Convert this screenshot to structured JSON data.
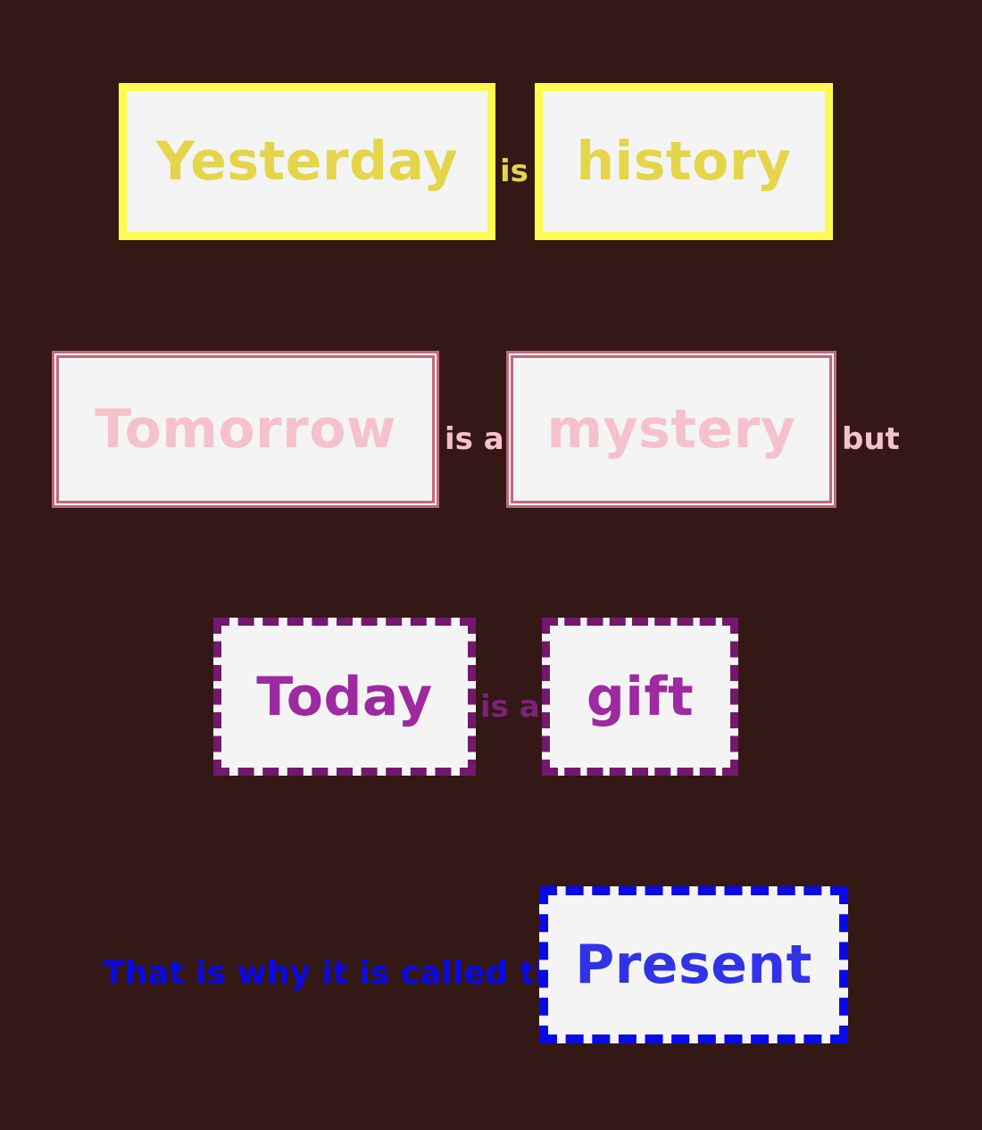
{
  "row1": {
    "word1": "Yesterday",
    "link": "is",
    "word2": "history"
  },
  "row2": {
    "word1": "Tomorrow",
    "link": "is a",
    "word2": "mystery",
    "trail": "but"
  },
  "row3": {
    "word1": "Today",
    "link": "is a",
    "word2": "gift"
  },
  "row4": {
    "lead": "That is why it is called the",
    "word": "Present"
  },
  "colors": {
    "background": "#341816",
    "yellow_border": "#fdfb52",
    "yellow_text": "#e4d54a",
    "pink_border": "#c2687b",
    "pink_text": "#f5c1cd",
    "purple_border": "#72196d",
    "purple_text": "#9d2aa0",
    "blue_border": "#0a0ae6",
    "blue_text": "#3232e6"
  }
}
